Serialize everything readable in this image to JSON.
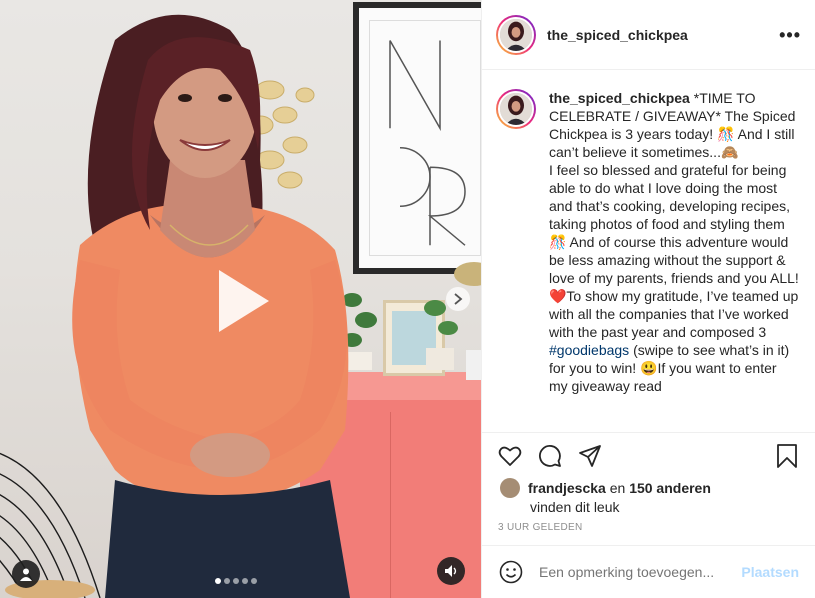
{
  "post": {
    "username": "the_spiced_chickpea",
    "more_icon": "more-horizontal-icon",
    "caption": {
      "username": "the_spiced_chickpea",
      "text_part1": " *TIME TO CELEBRATE / GIVEAWAY* The Spiced Chickpea is 3 years today! 🎊 And I still can’t believe it sometimes...🙈",
      "text_part2": "I feel so blessed and grateful for being able to do what I love doing the most and that’s cooking, developing recipes, taking photos of food and styling them 🎊 And of course this adventure would be less amazing without the support & love of my parents, friends and you ALL! ❤️To show my gratitude, I’ve teamed up with all the companies that I’ve worked with the past year and composed 3 ",
      "hashtag": "#goodiebags",
      "text_part3": " (swipe to see what’s in it) for you to win! 😃If you want to enter my giveaway read"
    },
    "likes": {
      "liker": "frandjescka",
      "connector": " en ",
      "others": "150 anderen",
      "suffix": "vinden dit leuk"
    },
    "timestamp": "3 uur geleden",
    "comment": {
      "placeholder": "Een opmerking toevoegen...",
      "post_label": "Plaatsen"
    },
    "carousel": {
      "total_slides": 5,
      "active_slide": 1
    }
  },
  "icons": [
    "heart-icon",
    "comment-icon",
    "share-icon",
    "bookmark-icon",
    "emoji-icon",
    "play-icon",
    "next-arrow-icon",
    "sound-icon",
    "user-tag-icon"
  ],
  "colors": {
    "text": "#262626",
    "muted": "#8e8e8e",
    "link": "#00376b",
    "post_disabled": "#b3dbff",
    "border": "#efefef"
  }
}
